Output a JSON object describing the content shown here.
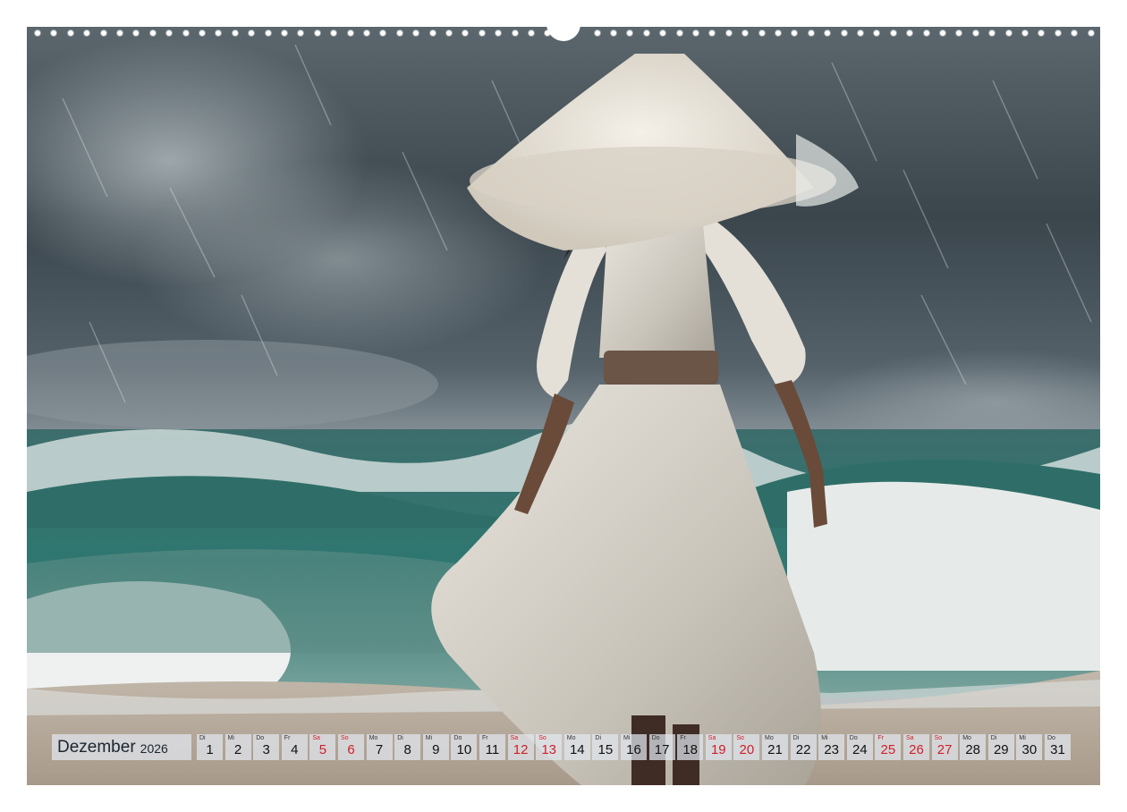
{
  "calendar": {
    "month": "Dezember",
    "year": "2026",
    "weekend_color": "#d0202a",
    "days": [
      {
        "wd": "Di",
        "n": "1",
        "we": false
      },
      {
        "wd": "Mi",
        "n": "2",
        "we": false
      },
      {
        "wd": "Do",
        "n": "3",
        "we": false
      },
      {
        "wd": "Fr",
        "n": "4",
        "we": false
      },
      {
        "wd": "Sa",
        "n": "5",
        "we": true
      },
      {
        "wd": "So",
        "n": "6",
        "we": true
      },
      {
        "wd": "Mo",
        "n": "7",
        "we": false
      },
      {
        "wd": "Di",
        "n": "8",
        "we": false
      },
      {
        "wd": "Mi",
        "n": "9",
        "we": false
      },
      {
        "wd": "Do",
        "n": "10",
        "we": false
      },
      {
        "wd": "Fr",
        "n": "11",
        "we": false
      },
      {
        "wd": "Sa",
        "n": "12",
        "we": true
      },
      {
        "wd": "So",
        "n": "13",
        "we": true
      },
      {
        "wd": "Mo",
        "n": "14",
        "we": false
      },
      {
        "wd": "Di",
        "n": "15",
        "we": false
      },
      {
        "wd": "Mi",
        "n": "16",
        "we": false
      },
      {
        "wd": "Do",
        "n": "17",
        "we": false
      },
      {
        "wd": "Fr",
        "n": "18",
        "we": false
      },
      {
        "wd": "Sa",
        "n": "19",
        "we": true
      },
      {
        "wd": "So",
        "n": "20",
        "we": true
      },
      {
        "wd": "Mo",
        "n": "21",
        "we": false
      },
      {
        "wd": "Di",
        "n": "22",
        "we": false
      },
      {
        "wd": "Mi",
        "n": "23",
        "we": false
      },
      {
        "wd": "Do",
        "n": "24",
        "we": false
      },
      {
        "wd": "Fr",
        "n": "25",
        "we": true
      },
      {
        "wd": "Sa",
        "n": "26",
        "we": true
      },
      {
        "wd": "So",
        "n": "27",
        "we": true
      },
      {
        "wd": "Mo",
        "n": "28",
        "we": false
      },
      {
        "wd": "Di",
        "n": "29",
        "we": false
      },
      {
        "wd": "Mi",
        "n": "30",
        "we": false
      },
      {
        "wd": "Do",
        "n": "31",
        "we": false
      }
    ]
  }
}
